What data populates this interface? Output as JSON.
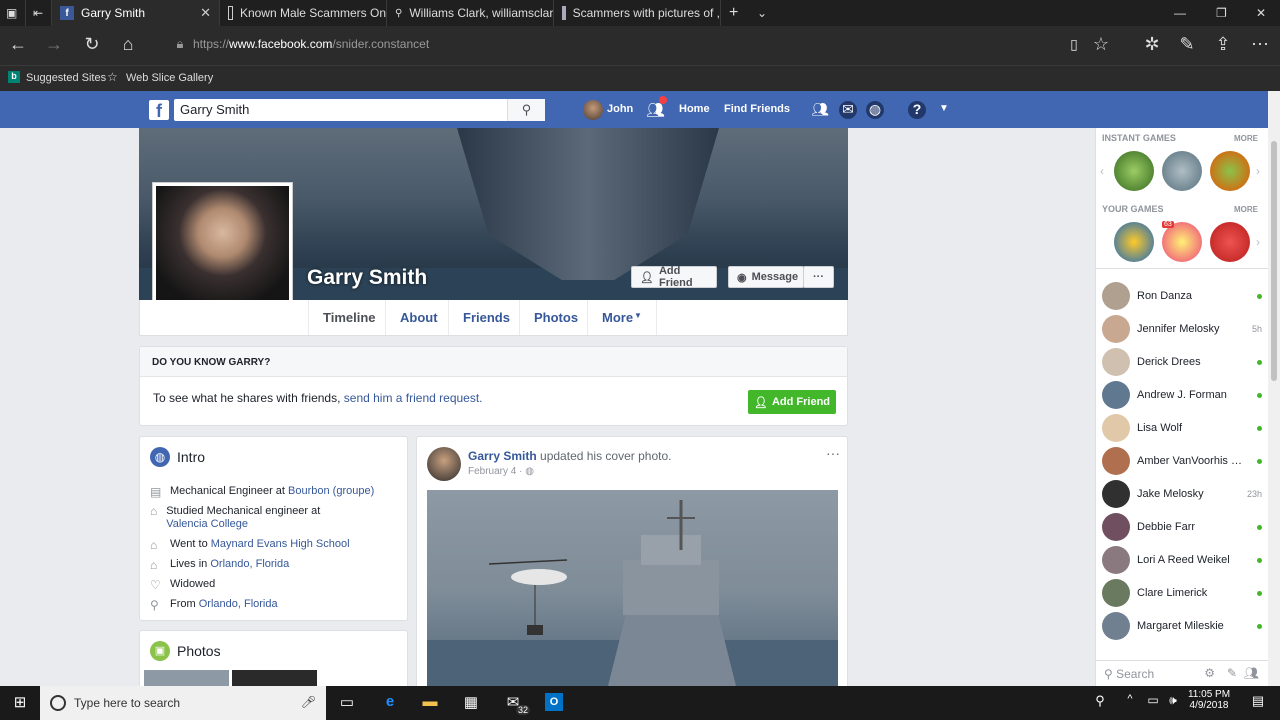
{
  "browser": {
    "tabs": [
      {
        "title": "Garry Smith",
        "icon": "facebook-icon",
        "active": true
      },
      {
        "title": "Known Male Scammers On",
        "icon": "page-icon",
        "active": false
      },
      {
        "title": "Williams Clark, williamsclark",
        "icon": "search-icon",
        "active": false
      },
      {
        "title": "Scammers with pictures of ,",
        "icon": "image-icon",
        "active": false
      }
    ],
    "url_prefix": "https://",
    "url_domain": "www.facebook.com",
    "url_path": "/snider.constancet",
    "favorites": {
      "suggested": "Suggested Sites",
      "webslice": "Web Slice Gallery"
    }
  },
  "fb_header": {
    "search_value": "Garry Smith",
    "user_name": "John",
    "home": "Home",
    "find_friends": "Find Friends"
  },
  "profile": {
    "name": "Garry Smith",
    "add_friend": "Add Friend",
    "message": "Message",
    "more_dots": "···",
    "tabs": [
      "Timeline",
      "About",
      "Friends",
      "Photos",
      "More"
    ]
  },
  "know_card": {
    "heading": "DO YOU KNOW GARRY?",
    "text": "To see what he shares with friends, ",
    "link": "send him a friend request.",
    "button": "Add Friend"
  },
  "intro": {
    "title": "Intro",
    "rows": [
      {
        "icon": "briefcase-icon",
        "prefix": "Mechanical Engineer at ",
        "link": "Bourbon (groupe)"
      },
      {
        "icon": "graduation-cap-icon",
        "prefix": "Studied Mechanical engineer at ",
        "link": "Valencia College"
      },
      {
        "icon": "graduation-cap-icon",
        "prefix": "Went to ",
        "link": "Maynard Evans High School"
      },
      {
        "icon": "home-icon",
        "prefix": "Lives in ",
        "link": "Orlando, Florida"
      },
      {
        "icon": "heart-icon",
        "prefix": "Widowed",
        "link": ""
      },
      {
        "icon": "location-pin-icon",
        "prefix": "From ",
        "link": "Orlando, Florida"
      }
    ]
  },
  "photos_card": {
    "title": "Photos"
  },
  "post": {
    "author": "Garry Smith",
    "action": " updated his cover photo.",
    "date": "February 4 · ",
    "menu": "···"
  },
  "sidebar": {
    "instant_games": "INSTANT GAMES",
    "your_games": "YOUR GAMES",
    "more": "MORE",
    "badge": "63",
    "friends": [
      {
        "name": "Ron Danza",
        "status": "online"
      },
      {
        "name": "Jennifer Melosky",
        "status": "5h"
      },
      {
        "name": "Derick Drees",
        "status": "online"
      },
      {
        "name": "Andrew J. Forman",
        "status": "online"
      },
      {
        "name": "Lisa Wolf",
        "status": "online"
      },
      {
        "name": "Amber VanVoorhis W...",
        "status": "online"
      },
      {
        "name": "Jake Melosky",
        "status": "23h"
      },
      {
        "name": "Debbie Farr",
        "status": "online"
      },
      {
        "name": "Lori A Reed Weikel",
        "status": "online"
      },
      {
        "name": "Clare Limerick",
        "status": "online"
      },
      {
        "name": "Margaret Mileskie",
        "status": "online"
      }
    ],
    "search_placeholder": "Search"
  },
  "taskbar": {
    "search_placeholder": "Type here to search",
    "mail_badge": "32",
    "time": "11:05 PM",
    "date": "4/9/2018"
  },
  "colors": {
    "fb_blue": "#4267b2",
    "link": "#365899",
    "green": "#42b72a"
  }
}
